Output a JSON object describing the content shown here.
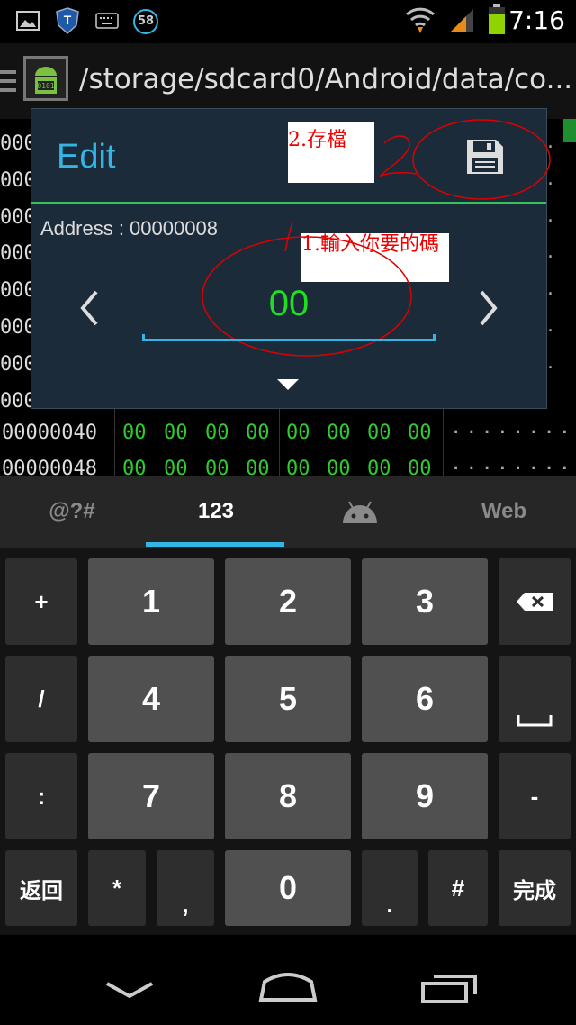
{
  "status_bar": {
    "time": "7:16",
    "notification_badge": "58",
    "icons": [
      "image-icon",
      "shield-icon",
      "keyboard-icon",
      "badge-icon",
      "wifi-icon",
      "signal-icon",
      "battery-icon"
    ]
  },
  "action_bar": {
    "path": "/storage/sdcard0/Android/data/co...",
    "icons": [
      "menu-icon",
      "app-icon"
    ]
  },
  "hex_view": {
    "rows": [
      {
        "address": "00000040",
        "bytes": [
          "00",
          "00",
          "00",
          "00",
          "00",
          "00",
          "00",
          "00"
        ],
        "ascii": "........"
      },
      {
        "address": "00000048",
        "bytes": [
          "00",
          "00",
          "00",
          "00",
          "00",
          "00",
          "00",
          "00"
        ],
        "ascii": "........"
      }
    ],
    "partial_address": "000",
    "ascii_dots": "."
  },
  "dialog": {
    "title": "Edit",
    "address_label": "Address : 00000008",
    "value": "00",
    "annotation_save": "2.存檔",
    "annotation_input": "1.輸入你要的碼",
    "colors": {
      "title": "#33b5e5",
      "value": "#1fe01f",
      "divider": "#35c35d",
      "annotation": "#e00000"
    }
  },
  "keyboard": {
    "tabs": [
      "@?#",
      "123",
      "",
      "Web"
    ],
    "active_tab": "123",
    "rows": [
      [
        "+",
        "1",
        "2",
        "3",
        ""
      ],
      [
        "/",
        "4",
        "5",
        "6",
        ""
      ],
      [
        ":",
        "7",
        "8",
        "9",
        "-"
      ],
      [
        "返回",
        "*",
        ",",
        "0",
        ".",
        "#",
        "完成"
      ]
    ]
  },
  "nav_bar": {
    "icons": [
      "back-icon",
      "home-icon",
      "recents-icon"
    ]
  }
}
